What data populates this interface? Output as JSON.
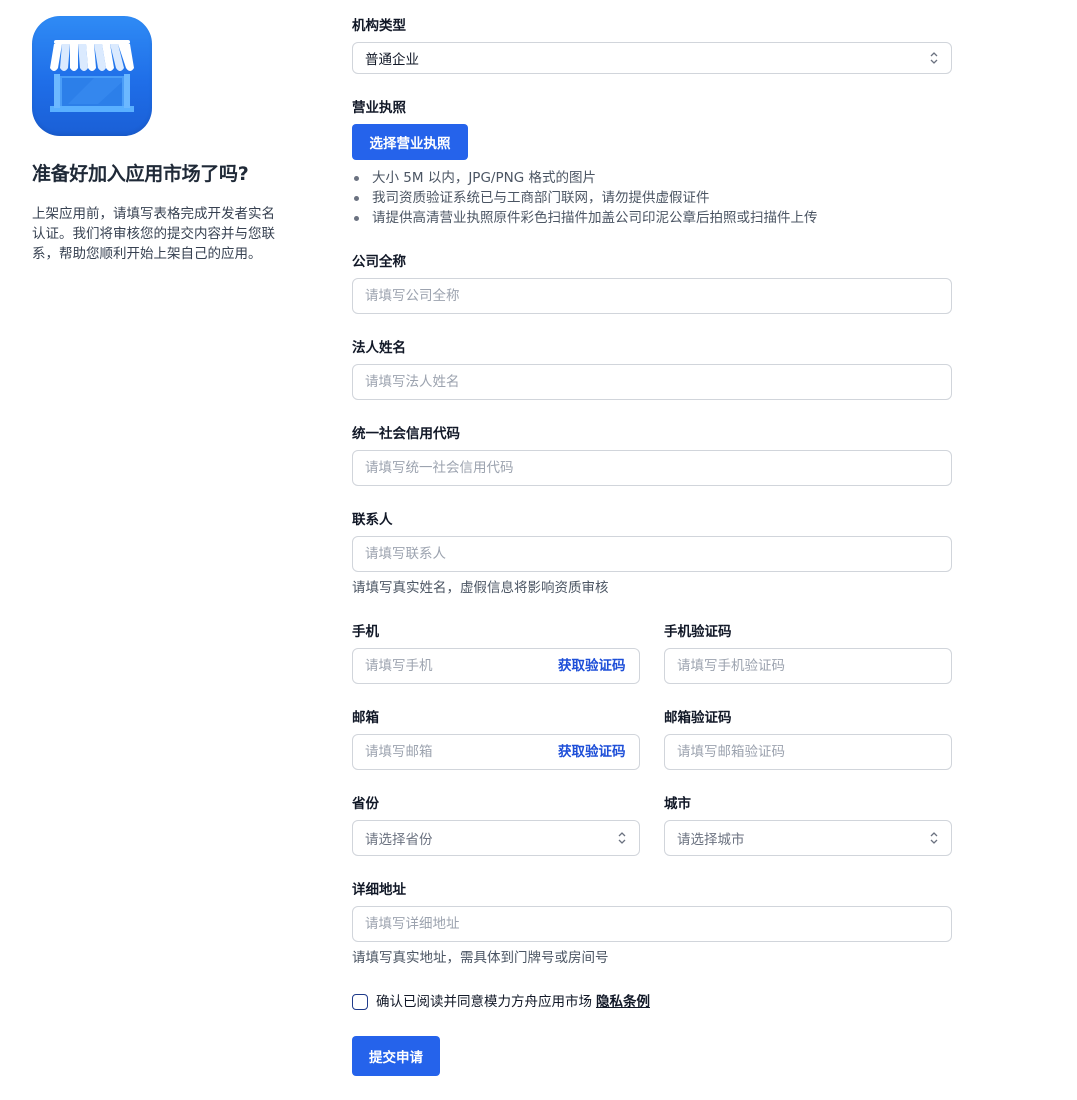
{
  "sidebar": {
    "title": "准备好加入应用市场了吗?",
    "description": "上架应用前，请填写表格完成开发者实名认证。我们将审核您的提交内容并与您联系，帮助您顺利开始上架自己的应用。",
    "icon": "storefront-icon"
  },
  "form": {
    "org_type": {
      "label": "机构类型",
      "value": "普通企业"
    },
    "license": {
      "label": "营业执照",
      "button": "选择营业执照",
      "notes": [
        "大小 5M 以内，JPG/PNG 格式的图片",
        "我司资质验证系统已与工商部门联网，请勿提供虚假证件",
        "请提供高清营业执照原件彩色扫描件加盖公司印泥公章后拍照或扫描件上传"
      ]
    },
    "company_name": {
      "label": "公司全称",
      "placeholder": "请填写公司全称"
    },
    "legal_person": {
      "label": "法人姓名",
      "placeholder": "请填写法人姓名"
    },
    "credit_code": {
      "label": "统一社会信用代码",
      "placeholder": "请填写统一社会信用代码"
    },
    "contact": {
      "label": "联系人",
      "placeholder": "请填写联系人",
      "hint": "请填写真实姓名，虚假信息将影响资质审核"
    },
    "phone": {
      "label": "手机",
      "placeholder": "请填写手机",
      "action": "获取验证码"
    },
    "phone_code": {
      "label": "手机验证码",
      "placeholder": "请填写手机验证码"
    },
    "email": {
      "label": "邮箱",
      "placeholder": "请填写邮箱",
      "action": "获取验证码"
    },
    "email_code": {
      "label": "邮箱验证码",
      "placeholder": "请填写邮箱验证码"
    },
    "province": {
      "label": "省份",
      "placeholder": "请选择省份"
    },
    "city": {
      "label": "城市",
      "placeholder": "请选择城市"
    },
    "address": {
      "label": "详细地址",
      "placeholder": "请填写详细地址",
      "hint": "请填写真实地址，需具体到门牌号或房间号"
    },
    "agreement": {
      "text": "确认已阅读并同意模力方舟应用市场",
      "link": "隐私条例"
    },
    "submit": "提交申请"
  },
  "colors": {
    "primary": "#2563eb",
    "link": "#1d4ed8",
    "border": "#d1d5db"
  }
}
